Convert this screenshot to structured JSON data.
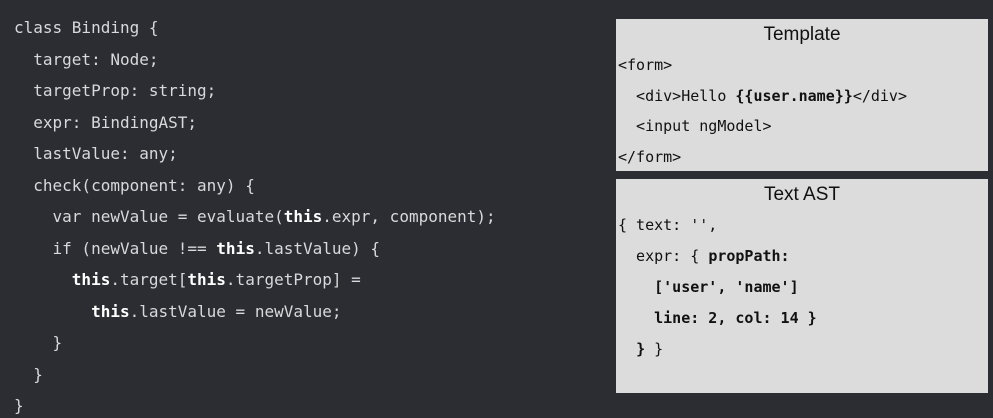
{
  "code": {
    "lines": [
      [
        {
          "t": "class Binding {"
        }
      ],
      [
        {
          "t": "  target: Node;"
        }
      ],
      [
        {
          "t": "  targetProp: string;"
        }
      ],
      [
        {
          "t": "  expr: BindingAST;"
        }
      ],
      [
        {
          "t": "  lastValue: any;"
        }
      ],
      [
        {
          "t": "  check(component: any) {"
        }
      ],
      [
        {
          "t": "    var newValue = evaluate("
        },
        {
          "t": "this",
          "b": true
        },
        {
          "t": ".expr, component);"
        }
      ],
      [
        {
          "t": "    if (newValue !== "
        },
        {
          "t": "this",
          "b": true
        },
        {
          "t": ".lastValue) {"
        }
      ],
      [
        {
          "t": "      "
        },
        {
          "t": "this",
          "b": true
        },
        {
          "t": ".target["
        },
        {
          "t": "this",
          "b": true
        },
        {
          "t": ".targetProp] ="
        }
      ],
      [
        {
          "t": "        "
        },
        {
          "t": "this",
          "b": true
        },
        {
          "t": ".lastValue = newValue;"
        }
      ],
      [
        {
          "t": "    }"
        }
      ],
      [
        {
          "t": "  }"
        }
      ],
      [
        {
          "t": "}"
        }
      ]
    ]
  },
  "template_panel": {
    "title": "Template",
    "lines": [
      [
        {
          "t": "<form>"
        }
      ],
      [
        {
          "t": "  <div>Hello "
        },
        {
          "t": "{{user.name}}",
          "b": true
        },
        {
          "t": "</div>"
        }
      ],
      [
        {
          "t": "  <input ngModel>"
        }
      ],
      [
        {
          "t": "</form>"
        }
      ]
    ]
  },
  "ast_panel": {
    "title": "Text AST",
    "lines": [
      [
        {
          "t": "{ text: '',"
        }
      ],
      [
        {
          "t": "  expr: { "
        },
        {
          "t": "propPath:",
          "b": true
        }
      ],
      [
        {
          "t": "    "
        },
        {
          "t": "['user', 'name']",
          "b": true
        }
      ],
      [
        {
          "t": "    "
        },
        {
          "t": "line: 2, col: 14 }",
          "b": true
        }
      ],
      [
        {
          "t": "  "
        },
        {
          "t": "}",
          "b": true
        },
        {
          "t": " }"
        }
      ]
    ]
  }
}
